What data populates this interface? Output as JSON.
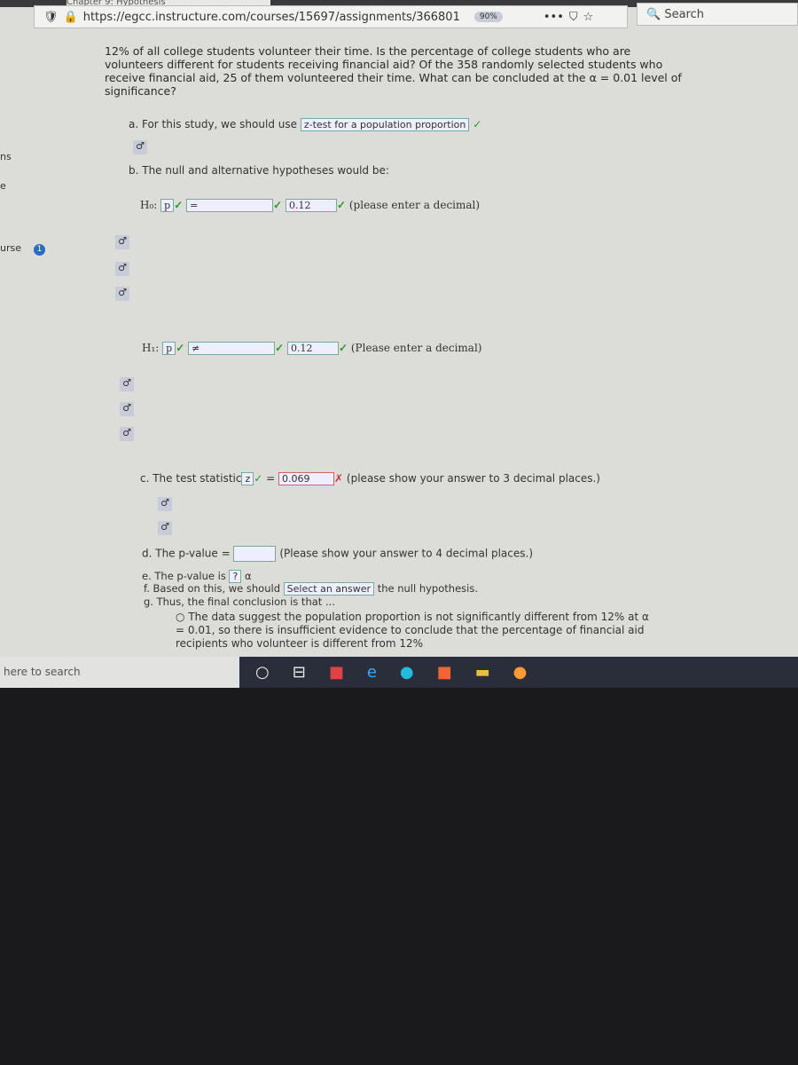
{
  "browser": {
    "tab_title": "Chapter 9: Hypothesis",
    "url": "https://egcc.instructure.com/courses/15697/assignments/366801",
    "zoom": "90%",
    "search_placeholder": "Search"
  },
  "sidebar": {
    "items": [
      "ns",
      "e",
      "urse"
    ],
    "badge": "1"
  },
  "question": "12% of all college students volunteer their time. Is the percentage of college students who are volunteers different for students receiving financial aid? Of the 358 randomly selected students who receive financial aid, 25 of them volunteered their time. What can be concluded at the α = 0.01 level of significance?",
  "a": {
    "label": "a. For this study, we should use",
    "value": "z-test for a population proportion"
  },
  "b": {
    "label": "b. The null and alternative hypotheses would be:",
    "h0": {
      "label": "H₀:",
      "param": "p",
      "op": "=",
      "value": "0.12",
      "hint": "(please enter a decimal)"
    },
    "h1": {
      "label": "H₁:",
      "param": "p",
      "op": "≠",
      "value": "0.12",
      "hint": "(Please enter a decimal)"
    }
  },
  "c": {
    "label": "c. The test statistic",
    "stat": "z",
    "eq": "=",
    "value": "0.069",
    "hint": "(please show your answer to 3 decimal places.)"
  },
  "d": {
    "label": "d. The p-value =",
    "value": "",
    "hint": "(Please show your answer to 4 decimal places.)"
  },
  "e": {
    "label": "e. The p-value is",
    "value": "?",
    "alpha": "α"
  },
  "f": {
    "label": "f. Based on this, we should",
    "value": "Select an answer",
    "suffix": "the null hypothesis."
  },
  "g": {
    "label": "g. Thus, the final conclusion is that ...",
    "option1": "The data suggest the population proportion is not significantly different from 12% at α = 0.01, so there is insufficient evidence to conclude that the percentage of financial aid recipients who volunteer is different from 12%"
  },
  "taskbar": {
    "search": "here to search"
  }
}
